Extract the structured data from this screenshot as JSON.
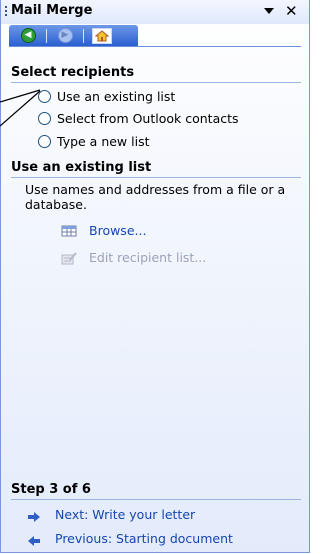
{
  "pane": {
    "title": "Mail Merge"
  },
  "select_recipients": {
    "heading": "Select recipients",
    "options": [
      {
        "label": "Use an existing list"
      },
      {
        "label": "Select from Outlook contacts"
      },
      {
        "label": "Type a new list"
      }
    ]
  },
  "existing_list": {
    "heading": "Use an existing list",
    "description": "Use names and addresses from a file or a database.",
    "browse_label": "Browse...",
    "edit_label": "Edit recipient list..."
  },
  "step": {
    "heading": "Step 3 of 6",
    "next_label": "Next: Write your letter",
    "previous_label": "Previous: Starting document"
  },
  "colors": {
    "accent": "#2a5fcf",
    "link": "#1646b0",
    "disabled": "#9aa3b8"
  }
}
